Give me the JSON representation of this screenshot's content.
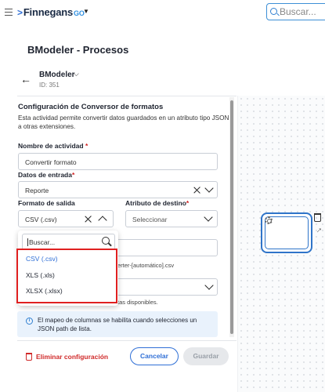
{
  "header": {
    "brand_name": "Finnegans",
    "brand_suffix": "GO",
    "search_placeholder": "Buscar..."
  },
  "page": {
    "title": "BModeler - Procesos"
  },
  "process": {
    "name": "BModeler",
    "id_label": "ID: 351"
  },
  "config": {
    "title": "Configuración de Conversor de formatos",
    "description": "Esta actividad permite convertir datos guardados en un atributo tipo JSON a otras extensiones.",
    "activity_name_label": "Nombre de actividad",
    "activity_name_value": "Convertir formato",
    "input_data_label": "Datos de entrada",
    "input_data_value": "Reporte",
    "output_format_label": "Formato de salida",
    "output_format_value": "CSV (.csv)",
    "target_attr_label": "Atributo de destino",
    "target_attr_placeholder": "Seleccionar",
    "filename_hint": "erter-[automático].csv",
    "columns_hint": "tas disponibles.",
    "required_mark": "*"
  },
  "dropdown": {
    "search_placeholder": "Buscar...",
    "options": [
      "CSV (.csv)",
      "XLS (.xls)",
      "XLSX (.xlsx)"
    ],
    "selected_index": 0
  },
  "info_banner": {
    "text": "El mapeo de columnas se habilita cuando selecciones un JSON path de lista."
  },
  "footer": {
    "delete_label": "Eliminar configuración",
    "cancel_label": "Cancelar",
    "save_label": "Guardar"
  },
  "colors": {
    "accent": "#2f6fd6",
    "danger": "#d02a2a",
    "highlight_box": "#e02020",
    "info_bg": "#e9f2fc"
  }
}
